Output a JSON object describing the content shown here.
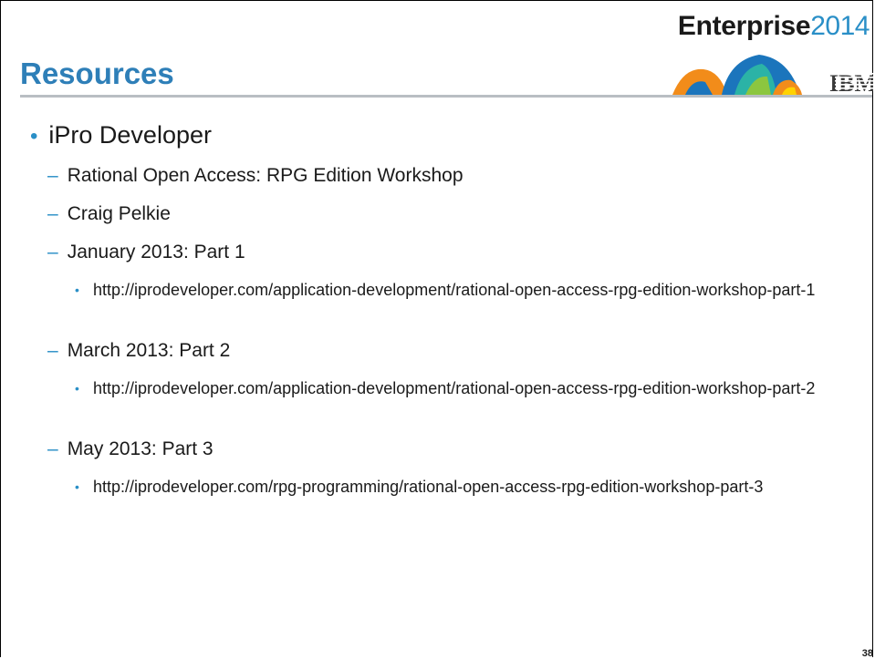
{
  "header": {
    "brand_bold": "Enterprise",
    "brand_year": "2014",
    "title": "Resources",
    "ibm_logo_text": "IBM"
  },
  "bullets": {
    "l1": "iPro Developer",
    "items": [
      "Rational Open Access: RPG Edition Workshop",
      "Craig Pelkie",
      "January 2013: Part 1",
      "http://iprodeveloper.com/application-development/rational-open-access-rpg-edition-workshop-part-1",
      "March 2013: Part 2",
      "http://iprodeveloper.com/application-development/rational-open-access-rpg-edition-workshop-part-2",
      "May 2013: Part 3",
      "http://iprodeveloper.com/rpg-programming/rational-open-access-rpg-edition-workshop-part-3"
    ]
  },
  "footer": {
    "page_number": "38"
  },
  "colors": {
    "title": "#2e7fb8",
    "accent": "#2a8fc7",
    "rule": "#b9bec3"
  }
}
